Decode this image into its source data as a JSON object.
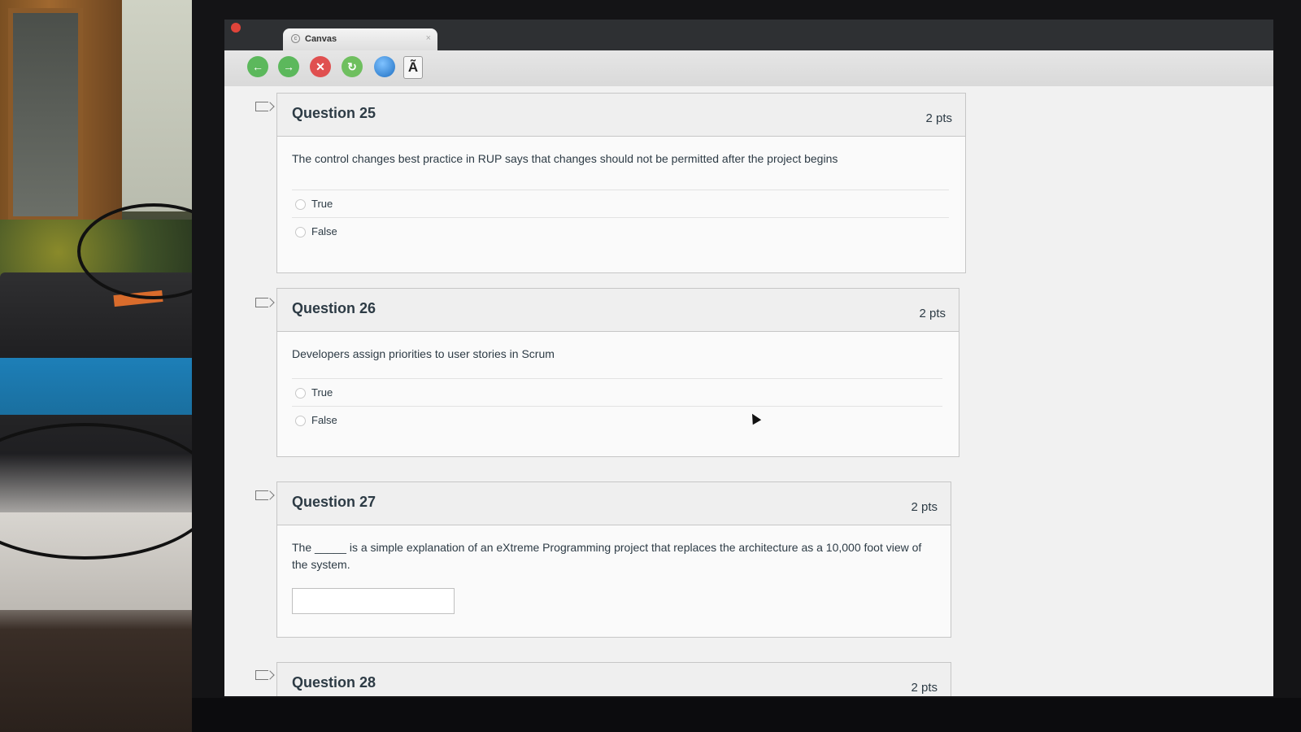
{
  "browser": {
    "tab_title": "Canvas",
    "tab_close": "×",
    "font_button": "Ã"
  },
  "questions": [
    {
      "title": "Question 25",
      "points": "2 pts",
      "text": "The control changes best practice in RUP says that changes should not be permitted after the project begins",
      "answers": [
        "True",
        "False"
      ]
    },
    {
      "title": "Question 26",
      "points": "2 pts",
      "text": "Developers assign priorities to user stories in Scrum",
      "answers": [
        "True",
        "False"
      ]
    },
    {
      "title": "Question 27",
      "points": "2 pts",
      "text": "The _____ is a simple explanation of an eXtreme Programming project that replaces the architecture as a 10,000 foot view of the system."
    },
    {
      "title": "Question 28",
      "points": "2 pts"
    }
  ]
}
